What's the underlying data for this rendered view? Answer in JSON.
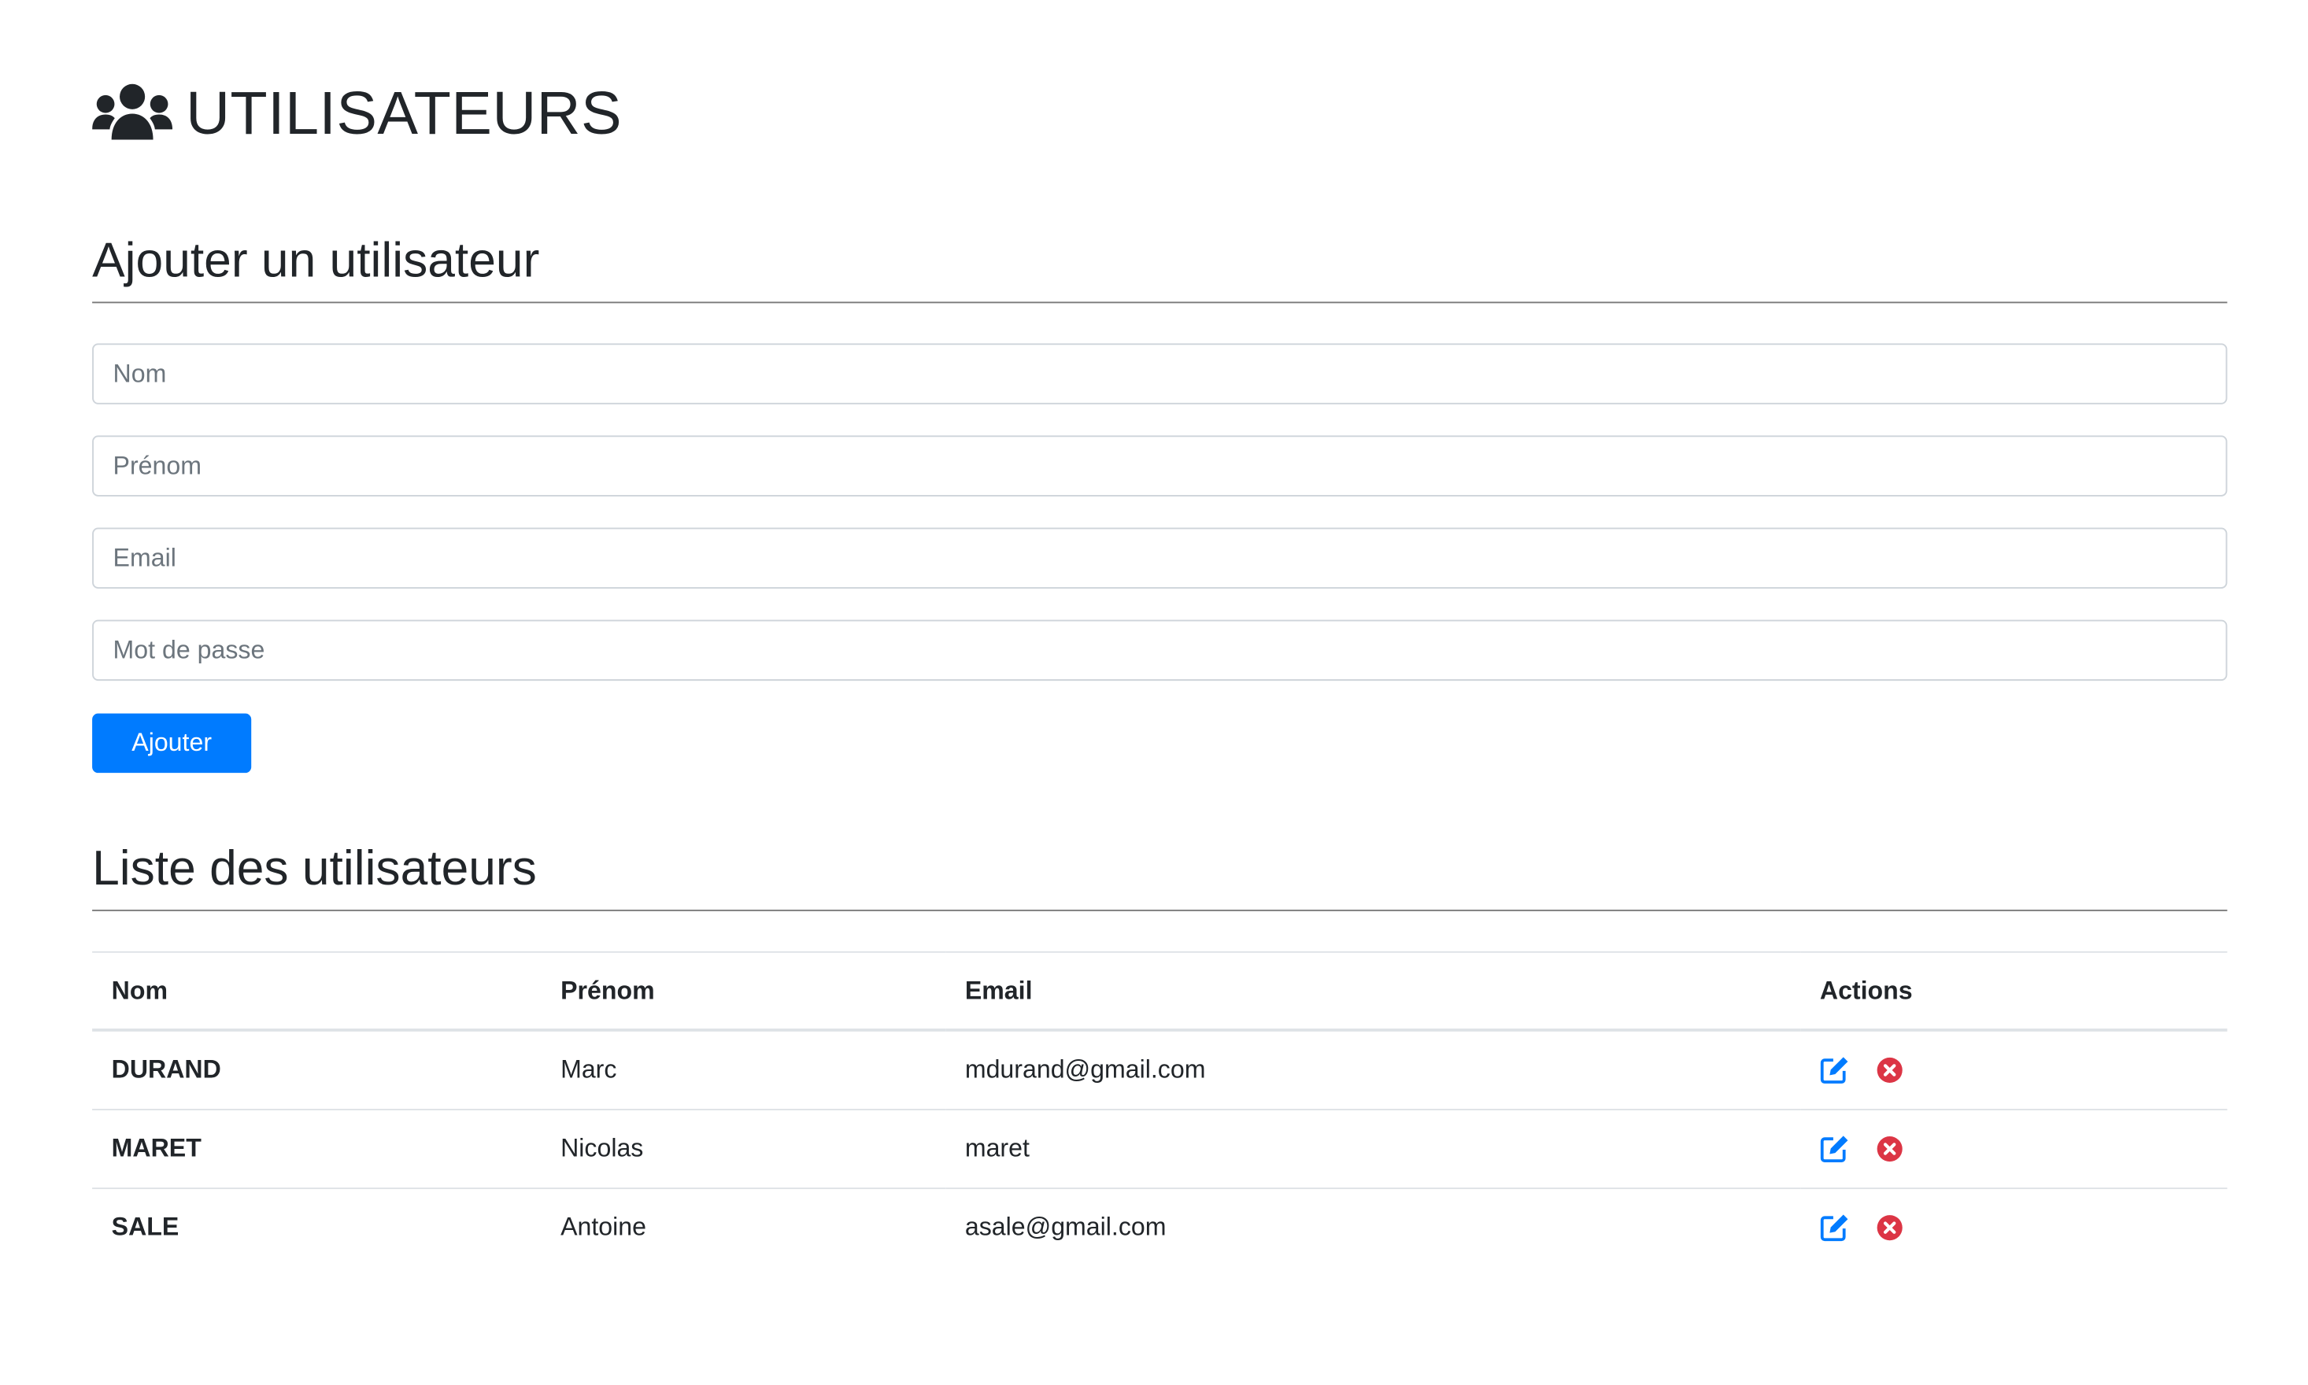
{
  "header": {
    "title": "UTILISATEURS",
    "icon": "users-icon"
  },
  "add_section": {
    "title": "Ajouter un utilisateur",
    "fields": [
      {
        "name": "nom",
        "placeholder": "Nom",
        "value": ""
      },
      {
        "name": "prenom",
        "placeholder": "Prénom",
        "value": ""
      },
      {
        "name": "email",
        "placeholder": "Email",
        "value": ""
      },
      {
        "name": "password",
        "placeholder": "Mot de passe",
        "value": ""
      }
    ],
    "submit_label": "Ajouter"
  },
  "list_section": {
    "title": "Liste des utilisateurs",
    "columns": [
      "Nom",
      "Prénom",
      "Email",
      "Actions"
    ],
    "rows": [
      {
        "nom": "DURAND",
        "prenom": "Marc",
        "email": "mdurand@gmail.com",
        "actions": [
          "edit-icon",
          "delete-icon"
        ]
      },
      {
        "nom": "MARET",
        "prenom": "Nicolas",
        "email": "maret",
        "actions": [
          "edit-icon",
          "delete-icon"
        ]
      },
      {
        "nom": "SALE",
        "prenom": "Antoine",
        "email": "asale@gmail.com",
        "actions": [
          "edit-icon",
          "delete-icon"
        ]
      }
    ]
  },
  "colors": {
    "primary": "#007bff",
    "danger": "#dc3545",
    "text": "#212529"
  }
}
